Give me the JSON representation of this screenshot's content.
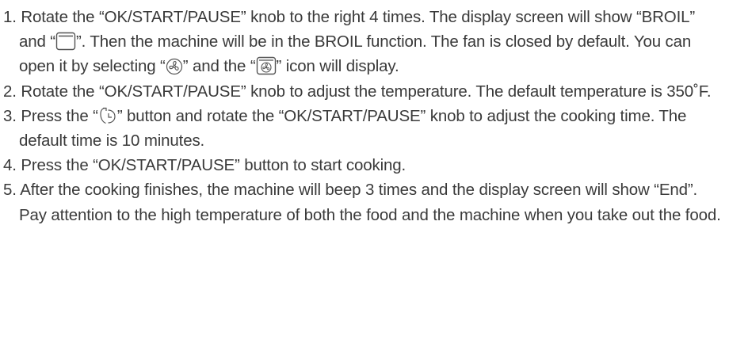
{
  "steps": [
    {
      "t1": "1. Rotate the “OK/START/PAUSE” knob to the right 4 times. The display screen will show “BROIL” and “",
      "icon1": "broil-element-icon",
      "t2": "”.  Then the machine will be in the BROIL function. The fan is closed by default. You can open it by selecting “",
      "icon2": "fan-button-icon",
      "t3": "” and the “",
      "icon3": "fan-display-icon",
      "t4": "” icon will display."
    },
    {
      "t1": "2. Rotate the “OK/START/PAUSE” knob to adjust the temperature. The default temperature is 350˚F."
    },
    {
      "t1": "3. Press the “",
      "icon1": "timer-button-icon",
      "t2": "” button and rotate the “OK/START/PAUSE” knob to adjust the cooking time. The default time is 10 minutes."
    },
    {
      "t1": "4. Press the “OK/START/PAUSE” button to start cooking."
    },
    {
      "t1": "5. After the cooking finishes, the machine will beep 3 times and the display screen will show “End”. Pay attention to the high temperature of both the food and the machine when you take out the food."
    }
  ],
  "colors": {
    "text": "#3a3a3a",
    "icon_stroke": "#555555"
  }
}
